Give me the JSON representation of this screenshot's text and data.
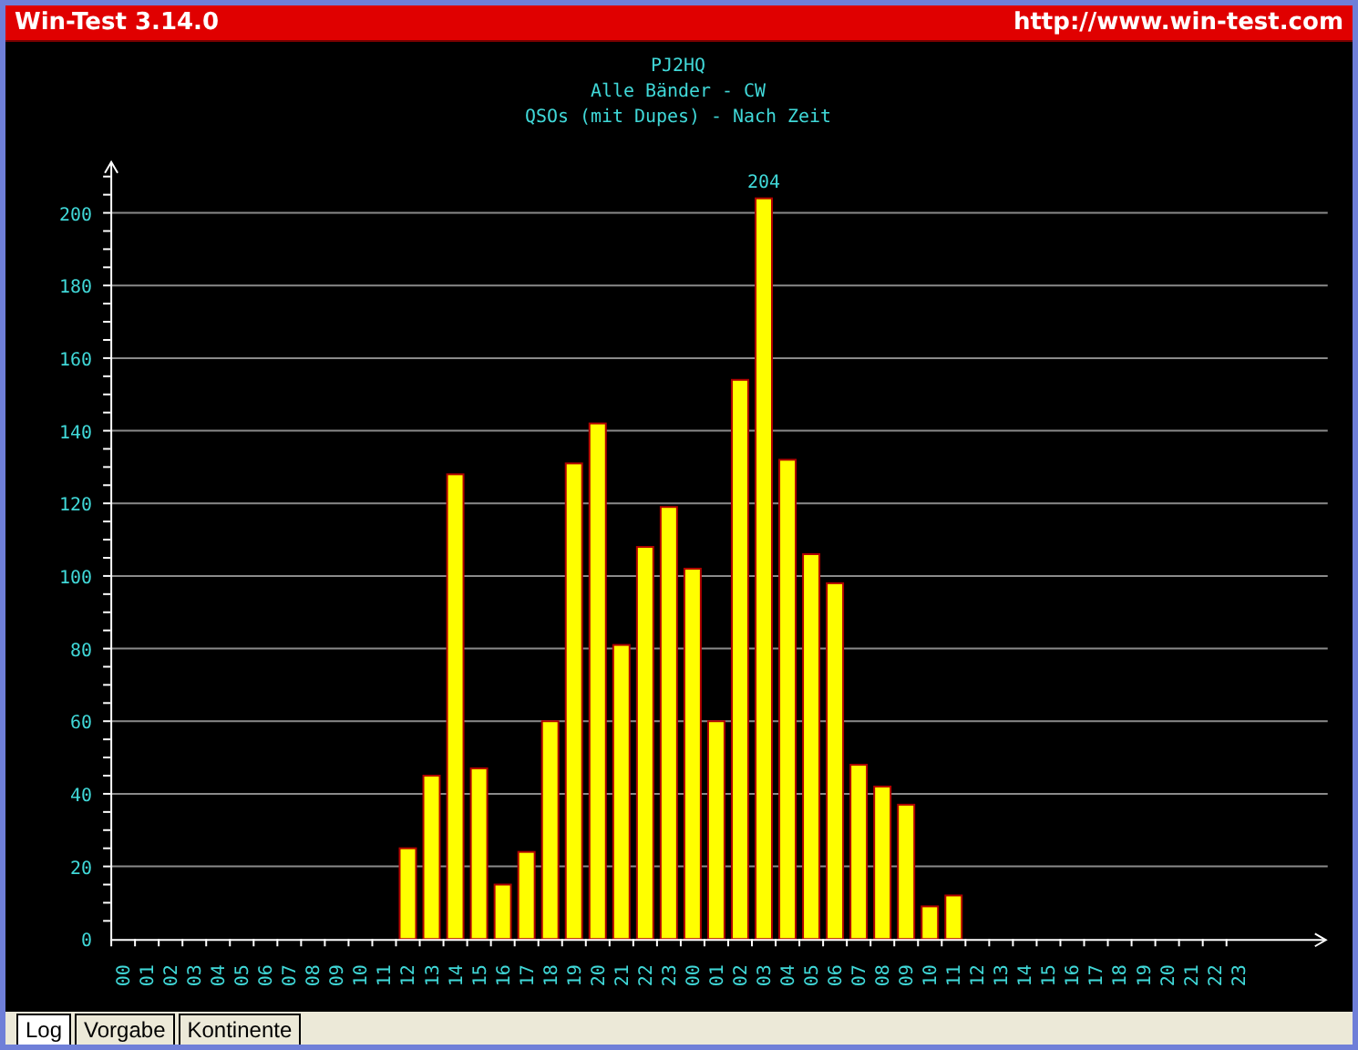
{
  "window": {
    "title": "Win-Test 3.14.0",
    "url": "http://www.win-test.com"
  },
  "chart": {
    "title_lines": [
      "PJ2HQ",
      "Alle Bänder - CW",
      "QSOs (mit Dupes) - Nach Zeit"
    ],
    "chart_data": {
      "type": "bar",
      "categories": [
        "00",
        "01",
        "02",
        "03",
        "04",
        "05",
        "06",
        "07",
        "08",
        "09",
        "10",
        "11",
        "12",
        "13",
        "14",
        "15",
        "16",
        "17",
        "18",
        "19",
        "20",
        "21",
        "22",
        "23",
        "00",
        "01",
        "02",
        "03",
        "04",
        "05",
        "06",
        "07",
        "08",
        "09",
        "10",
        "11",
        "12",
        "13",
        "14",
        "15",
        "16",
        "17",
        "18",
        "19",
        "20",
        "21",
        "22",
        "23"
      ],
      "values": [
        0,
        0,
        0,
        0,
        0,
        0,
        0,
        0,
        0,
        0,
        0,
        0,
        25,
        45,
        128,
        47,
        15,
        24,
        60,
        131,
        142,
        81,
        108,
        119,
        102,
        60,
        154,
        204,
        132,
        106,
        98,
        48,
        42,
        37,
        9,
        12,
        0,
        0,
        0,
        0,
        0,
        0,
        0,
        0,
        0,
        0,
        0,
        0
      ],
      "yticks": [
        0,
        20,
        40,
        60,
        80,
        100,
        120,
        140,
        160,
        180,
        200
      ],
      "ylim": [
        0,
        214
      ],
      "grid": true,
      "annotations": [
        "204"
      ]
    }
  },
  "tabs": [
    {
      "label": "Log",
      "selected": true
    },
    {
      "label": "Vorgabe",
      "selected": false
    },
    {
      "label": "Kontinente",
      "selected": false
    }
  ]
}
